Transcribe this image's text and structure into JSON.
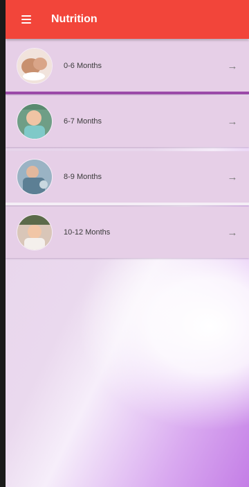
{
  "app_bar": {
    "title": "Nutrition",
    "menu_icon": "hamburger-menu-icon",
    "color": "#f2453a"
  },
  "items": [
    {
      "label": "0-6 Months",
      "avatar_icon": "baby-photo",
      "arrow_icon": "arrow-right-icon"
    },
    {
      "label": "6-7 Months",
      "avatar_icon": "baby-photo",
      "arrow_icon": "arrow-right-icon"
    },
    {
      "label": "8-9 Months",
      "avatar_icon": "baby-photo",
      "arrow_icon": "arrow-right-icon"
    },
    {
      "label": "10-12 Months",
      "avatar_icon": "baby-photo",
      "arrow_icon": "arrow-right-icon"
    }
  ],
  "colors": {
    "list_item_bg": "#e6cfe7",
    "background_accent": "#c47ee6"
  }
}
